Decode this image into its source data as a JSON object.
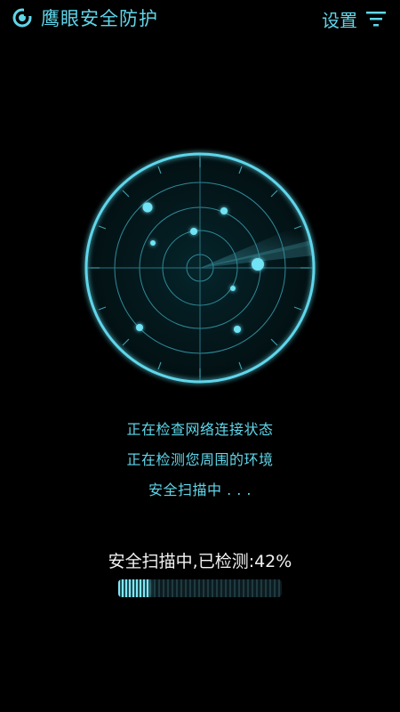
{
  "header": {
    "title": "鹰眼安全防护",
    "settings_label": "设置",
    "logo_icon": "app-logo-icon",
    "menu_icon": "menu-filter-icon"
  },
  "radar": {
    "label": "radar-scanner",
    "blip_count": 9
  },
  "status": {
    "line1": "正在检查网络连接状态",
    "line2": "正在检测您周围的环境",
    "line3": "安全扫描中 . . ."
  },
  "progress": {
    "text": "安全扫描中,已检测:42%",
    "percent": 42
  },
  "colors": {
    "accent": "#5fd6ea",
    "background": "#000000",
    "text_light": "#f2f2f2"
  }
}
